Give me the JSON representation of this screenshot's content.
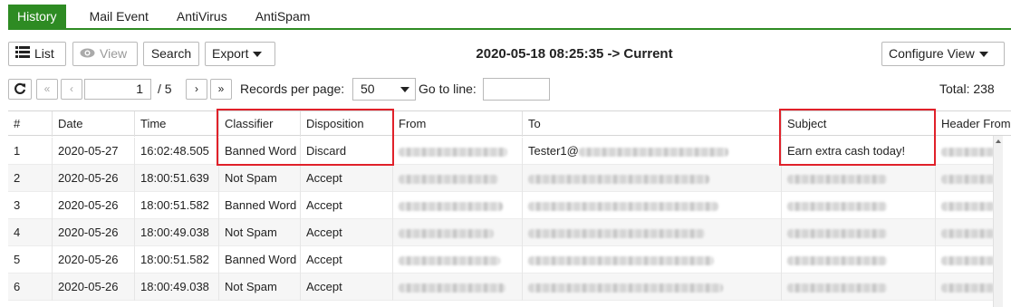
{
  "tabs": [
    "History",
    "Mail Event",
    "AntiVirus",
    "AntiSpam"
  ],
  "toolbar": {
    "list_label": "List",
    "view_label": "View",
    "search_label": "Search",
    "export_label": "Export",
    "configure_view_label": "Configure View",
    "date_range": "2020-05-18 08:25:35 -> Current"
  },
  "pager": {
    "current_page": "1",
    "total_pages": "/ 5",
    "records_per_page_label": "Records per page:",
    "records_per_page": "50",
    "go_to_line_label": "Go to line:",
    "go_to_line_value": "",
    "total": "Total: 238"
  },
  "table": {
    "columns": [
      "#",
      "Date",
      "Time",
      "Classifier",
      "Disposition",
      "From",
      "To",
      "Subject",
      "Header From"
    ],
    "rows": [
      {
        "num": "1",
        "date": "2020-05-27",
        "time": "16:02:48.505",
        "classifier": "Banned Word",
        "disposition": "Discard",
        "to": "Tester1@",
        "subject": "Earn extra cash today!"
      },
      {
        "num": "2",
        "date": "2020-05-26",
        "time": "18:00:51.639",
        "classifier": "Not Spam",
        "disposition": "Accept",
        "to": "",
        "subject": ""
      },
      {
        "num": "3",
        "date": "2020-05-26",
        "time": "18:00:51.582",
        "classifier": "Banned Word",
        "disposition": "Accept",
        "to": "",
        "subject": ""
      },
      {
        "num": "4",
        "date": "2020-05-26",
        "time": "18:00:49.038",
        "classifier": "Not Spam",
        "disposition": "Accept",
        "to": "",
        "subject": ""
      },
      {
        "num": "5",
        "date": "2020-05-26",
        "time": "18:00:51.582",
        "classifier": "Banned Word",
        "disposition": "Accept",
        "to": "",
        "subject": ""
      },
      {
        "num": "6",
        "date": "2020-05-26",
        "time": "18:00:49.038",
        "classifier": "Not Spam",
        "disposition": "Accept",
        "to": "",
        "subject": ""
      }
    ]
  },
  "colors": {
    "accent": "#2e8b23",
    "highlight": "#e0212a"
  },
  "icons": [
    "list-icon",
    "eye-icon",
    "refresh-icon",
    "first-page-icon",
    "prev-page-icon",
    "next-page-icon",
    "last-page-icon"
  ]
}
